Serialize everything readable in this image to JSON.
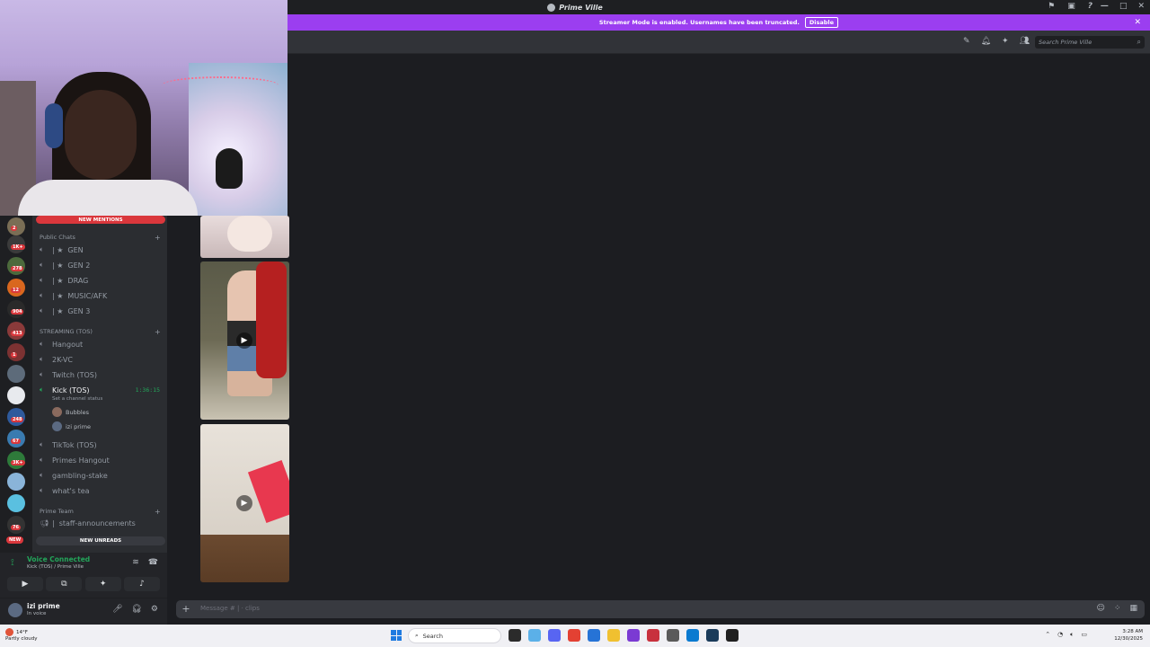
{
  "window": {
    "title": "Prime Ville"
  },
  "banner": {
    "text": "Streamer Mode is enabled. Usernames have been truncated.",
    "disable_label": "Disable",
    "color": "#9b3ef0"
  },
  "header": {
    "search_placeholder": "Search Prime Ville"
  },
  "channels": {
    "new_mentions": "NEW MENTIONS",
    "new_unreads": "NEW UNREADS",
    "public_category": "Public Chats",
    "public": [
      {
        "name": "GEN"
      },
      {
        "name": "GEN 2"
      },
      {
        "name": "DRAG"
      },
      {
        "name": "MUSIC/AFK"
      },
      {
        "name": "GEN 3"
      }
    ],
    "streaming_category": "STREAMING (TOS)",
    "streaming": [
      {
        "name": "Hangout"
      },
      {
        "name": "2K-VC"
      },
      {
        "name": "Twitch (TOS)"
      },
      {
        "name": "Kick (TOS)",
        "timer": "1:36:15",
        "status_prompt": "Set a channel status"
      }
    ],
    "voice_users": [
      "Bubbles",
      "izi prime"
    ],
    "other": [
      {
        "name": "TikTok (TOS)"
      },
      {
        "name": "Primes Hangout"
      },
      {
        "name": "gambling-stake"
      },
      {
        "name": "what's tea"
      }
    ],
    "team_category": "Prime Team",
    "team": [
      {
        "name": "staff-announcements"
      }
    ]
  },
  "rail_badges": [
    "2",
    "1K+",
    "278",
    "12",
    "904",
    "413",
    "1",
    "248",
    "67",
    "3K+",
    "76"
  ],
  "rail_new": "NEW",
  "voice": {
    "status": "Voice Connected",
    "location": "Kick (TOS) / Prime Ville"
  },
  "user": {
    "name": "izi prime",
    "status": "In voice"
  },
  "composer": {
    "placeholder": "Message # | · clips"
  },
  "taskbar": {
    "temp": "14°F",
    "weather": "Partly cloudy",
    "search": "Search",
    "time": "3:28 AM",
    "date": "12/30/2025"
  },
  "colors": {
    "accent": "#9b3ef0",
    "voice_green": "#23a55a",
    "mention_red": "#da373c"
  }
}
